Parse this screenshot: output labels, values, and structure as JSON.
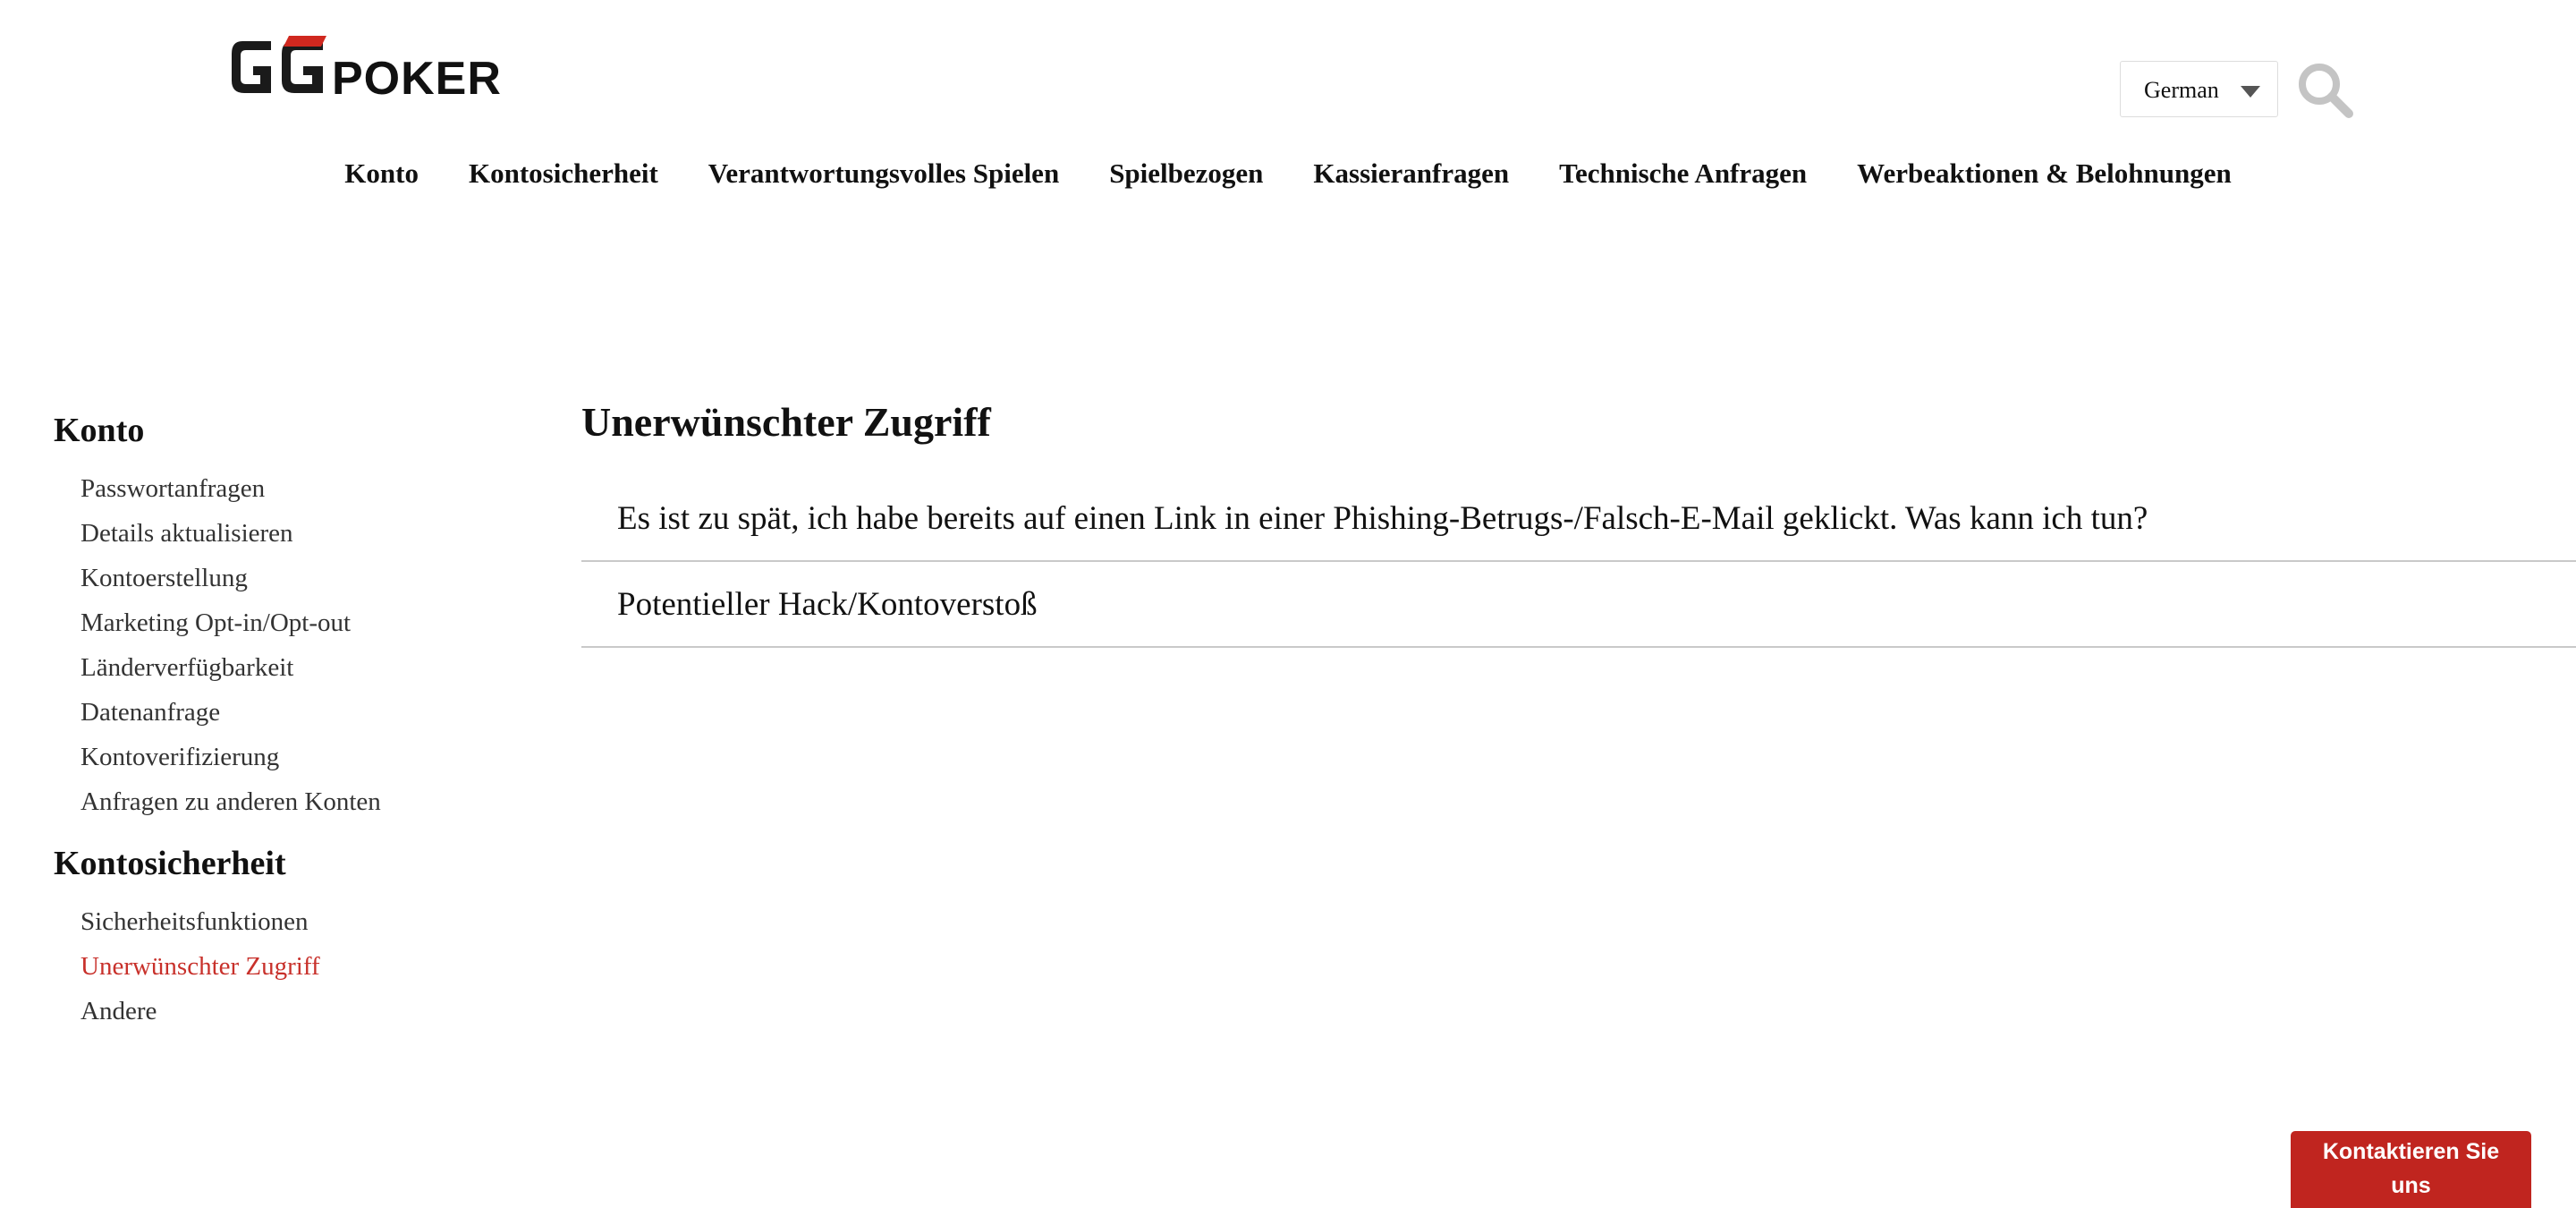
{
  "header": {
    "logo_text": "GGPOKER",
    "logo_word": "POKER",
    "language_selected": "German"
  },
  "nav": {
    "items": [
      {
        "label": "Konto"
      },
      {
        "label": "Kontosicherheit"
      },
      {
        "label": "Verantwortungsvolles Spielen"
      },
      {
        "label": "Spielbezogen"
      },
      {
        "label": "Kassieranfragen"
      },
      {
        "label": "Technische Anfragen"
      },
      {
        "label": "Werbeaktionen & Belohnungen"
      }
    ]
  },
  "sidebar": {
    "sections": [
      {
        "heading": "Konto",
        "items": [
          "Passwortanfragen",
          "Details aktualisieren",
          "Kontoerstellung",
          "Marketing Opt-in/Opt-out",
          "Länderverfügbarkeit",
          "Datenanfrage",
          "Kontoverifizierung",
          "Anfragen zu anderen Konten"
        ]
      },
      {
        "heading": "Kontosicherheit",
        "items": [
          "Sicherheitsfunktionen",
          "Unerwünschter Zugriff",
          "Andere"
        ]
      }
    ],
    "active_item": "Unerwünschter Zugriff"
  },
  "main": {
    "title": "Unerwünschter Zugriff",
    "articles": [
      "Es ist zu spät, ich habe bereits auf einen Link in einer Phishing-Betrugs-/Falsch-E-Mail geklickt. Was kann ich tun?",
      "Potentieller Hack/Kontoverstoß"
    ]
  },
  "contact": {
    "label_line1": "Kontaktieren Sie",
    "label_line2": "uns"
  },
  "colors": {
    "accent_red": "#c0251f",
    "active_link": "#c8312b",
    "logo_red": "#d0281f"
  },
  "icons": {
    "search": "search-icon",
    "dropdown": "chevron-down-icon"
  }
}
